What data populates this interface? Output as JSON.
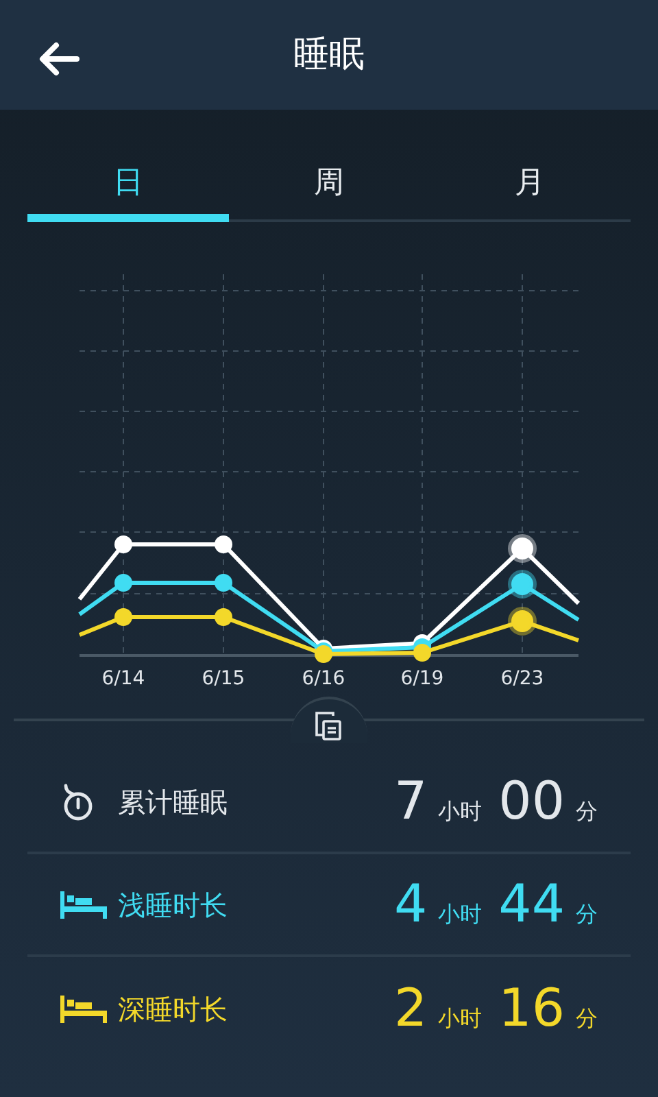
{
  "header": {
    "title": "睡眠"
  },
  "tabs": [
    {
      "label": "日",
      "selected": true
    },
    {
      "label": "周",
      "selected": false
    },
    {
      "label": "月",
      "selected": false
    }
  ],
  "chart": {
    "dates": [
      "6/14",
      "6/15",
      "6/16",
      "6/19",
      "6/23"
    ]
  },
  "stats": [
    {
      "kind": "stopwatch",
      "label": "累计睡眠",
      "hours": "7",
      "hours_unit": "小时",
      "minutes": "00",
      "minutes_unit": "分",
      "color": "#e3e7eb"
    },
    {
      "kind": "bed",
      "label": "浅睡时长",
      "hours": "4",
      "hours_unit": "小时",
      "minutes": "44",
      "minutes_unit": "分",
      "color": "#40dcf2"
    },
    {
      "kind": "bed",
      "label": "深睡时长",
      "hours": "2",
      "hours_unit": "小时",
      "minutes": "16",
      "minutes_unit": "分",
      "color": "#f3d82a"
    }
  ]
}
